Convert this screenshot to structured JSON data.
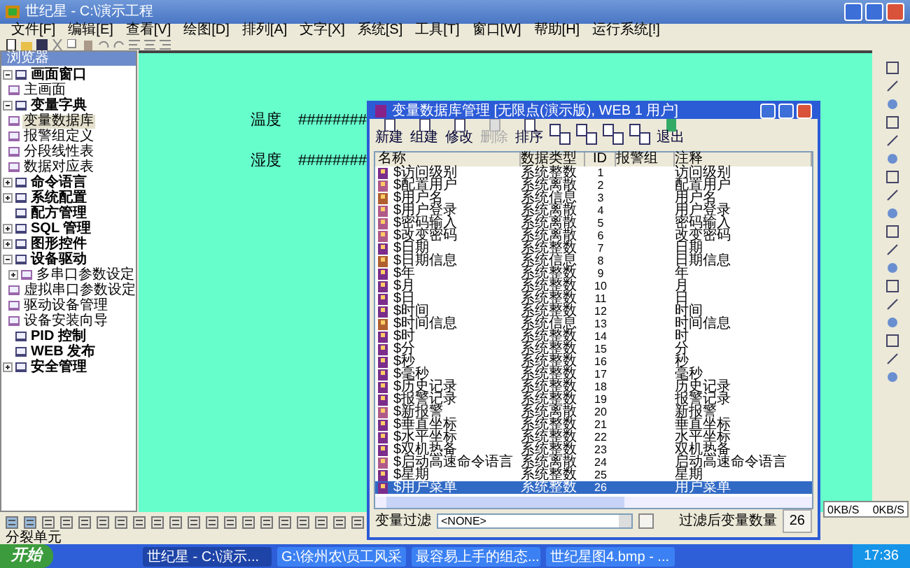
{
  "window": {
    "title": "世纪星 - C:\\演示工程"
  },
  "menu": [
    "文件[F]",
    "编辑[E]",
    "查看[V]",
    "绘图[D]",
    "排列[A]",
    "文字[X]",
    "系统[S]",
    "工具[T]",
    "窗口[W]",
    "帮助[H]",
    "运行系统[!]"
  ],
  "browser": {
    "title": "浏览器",
    "tree": [
      {
        "label": "画面窗口",
        "expanded": true,
        "children": [
          {
            "label": "主画面",
            "selected": false
          }
        ]
      },
      {
        "label": "变量字典",
        "expanded": true,
        "children": [
          {
            "label": "变量数据库",
            "selected": true
          },
          {
            "label": "报警组定义",
            "selected": false
          },
          {
            "label": "分段线性表",
            "selected": false
          },
          {
            "label": "数据对应表",
            "selected": false
          }
        ]
      },
      {
        "label": "命令语言",
        "expanded": false
      },
      {
        "label": "系统配置",
        "expanded": false
      },
      {
        "label": "配方管理"
      },
      {
        "label": "SQL 管理",
        "expanded": false
      },
      {
        "label": "图形控件",
        "expanded": false
      },
      {
        "label": "设备驱动",
        "expanded": true,
        "children": [
          {
            "label": "多串口参数设定",
            "selected": false,
            "expanded": false
          },
          {
            "label": "虚拟串口参数设定",
            "selected": false
          },
          {
            "label": "驱动设备管理",
            "selected": false
          },
          {
            "label": "设备安装向导",
            "selected": false
          }
        ]
      },
      {
        "label": "PID 控制"
      },
      {
        "label": "WEB 发布"
      },
      {
        "label": "安全管理",
        "expanded": false
      }
    ]
  },
  "canvas": {
    "fields": [
      {
        "label": "温度",
        "value": "########"
      },
      {
        "label": "湿度",
        "value": "########"
      }
    ]
  },
  "dialog": {
    "title": "变量数据库管理 [无限点(演示版), WEB 1 用户]",
    "toolbar": [
      {
        "label": "新建",
        "disabled": false
      },
      {
        "label": "组建",
        "disabled": false
      },
      {
        "label": "修改",
        "disabled": false
      },
      {
        "label": "删除",
        "disabled": true
      },
      {
        "label": "排序",
        "disabled": false
      }
    ],
    "exit_button": "退出",
    "columns": [
      "名称",
      "数据类型",
      "ID",
      "报警组",
      "注释"
    ],
    "rows": [
      {
        "kind": "integer",
        "name": "$访问级别",
        "type": "系统整数",
        "id": "1",
        "note": "访问级别",
        "selected": false
      },
      {
        "kind": "discrete",
        "name": "$配置用户",
        "type": "系统离散",
        "id": "2",
        "note": "配置用户",
        "selected": false
      },
      {
        "kind": "info",
        "name": "$用户名",
        "type": "系统信息",
        "id": "3",
        "note": "用户名",
        "selected": false
      },
      {
        "kind": "discrete",
        "name": "$用户登录",
        "type": "系统离散",
        "id": "4",
        "note": "用户登录",
        "selected": false
      },
      {
        "kind": "discrete",
        "name": "$密码输入",
        "type": "系统离散",
        "id": "5",
        "note": "密码输入",
        "selected": false
      },
      {
        "kind": "discrete",
        "name": "$改变密码",
        "type": "系统离散",
        "id": "6",
        "note": "改变密码",
        "selected": false
      },
      {
        "kind": "integer",
        "name": "$日期",
        "type": "系统整数",
        "id": "7",
        "note": "日期",
        "selected": false
      },
      {
        "kind": "info",
        "name": "$日期信息",
        "type": "系统信息",
        "id": "8",
        "note": "日期信息",
        "selected": false
      },
      {
        "kind": "integer",
        "name": "$年",
        "type": "系统整数",
        "id": "9",
        "note": "年",
        "selected": false
      },
      {
        "kind": "integer",
        "name": "$月",
        "type": "系统整数",
        "id": "10",
        "note": "月",
        "selected": false
      },
      {
        "kind": "integer",
        "name": "$日",
        "type": "系统整数",
        "id": "11",
        "note": "日",
        "selected": false
      },
      {
        "kind": "integer",
        "name": "$时间",
        "type": "系统整数",
        "id": "12",
        "note": "时间",
        "selected": false
      },
      {
        "kind": "info",
        "name": "$时间信息",
        "type": "系统信息",
        "id": "13",
        "note": "时间信息",
        "selected": false
      },
      {
        "kind": "integer",
        "name": "$时",
        "type": "系统整数",
        "id": "14",
        "note": "时",
        "selected": false
      },
      {
        "kind": "integer",
        "name": "$分",
        "type": "系统整数",
        "id": "15",
        "note": "分",
        "selected": false
      },
      {
        "kind": "integer",
        "name": "$秒",
        "type": "系统整数",
        "id": "16",
        "note": "秒",
        "selected": false
      },
      {
        "kind": "integer",
        "name": "$毫秒",
        "type": "系统整数",
        "id": "17",
        "note": "毫秒",
        "selected": false
      },
      {
        "kind": "integer",
        "name": "$历史记录",
        "type": "系统整数",
        "id": "18",
        "note": "历史记录",
        "selected": false
      },
      {
        "kind": "integer",
        "name": "$报警记录",
        "type": "系统整数",
        "id": "19",
        "note": "报警记录",
        "selected": false
      },
      {
        "kind": "discrete",
        "name": "$新报警",
        "type": "系统离散",
        "id": "20",
        "note": "新报警",
        "selected": false
      },
      {
        "kind": "integer",
        "name": "$垂直坐标",
        "type": "系统整数",
        "id": "21",
        "note": "垂直坐标",
        "selected": false
      },
      {
        "kind": "integer",
        "name": "$水平坐标",
        "type": "系统整数",
        "id": "22",
        "note": "水平坐标",
        "selected": false
      },
      {
        "kind": "integer",
        "name": "$双机热备",
        "type": "系统整数",
        "id": "23",
        "note": "双机热备",
        "selected": false
      },
      {
        "kind": "discrete",
        "name": "$启动高速命令语言",
        "type": "系统离散",
        "id": "24",
        "note": "启动高速命令语言",
        "selected": false
      },
      {
        "kind": "integer",
        "name": "$星期",
        "type": "系统整数",
        "id": "25",
        "note": "星期",
        "selected": false
      },
      {
        "kind": "integer",
        "name": "$用户菜单",
        "type": "系统整数",
        "id": "26",
        "note": "用户菜单",
        "selected": true
      }
    ],
    "filter": {
      "label": "变量过滤",
      "value": "<NONE>"
    },
    "count": {
      "label": "过滤后变量数量",
      "value": "26"
    }
  },
  "status_bar": "分裂单元",
  "net_speed": [
    "0KB/S",
    "0KB/S"
  ],
  "taskbar": {
    "start": "开始",
    "tasks": [
      {
        "label": "世纪星 - C:\\演示...",
        "selected": true
      },
      {
        "label": "G:\\徐州农\\员工风采",
        "selected": false
      },
      {
        "label": "最容易上手的组态...",
        "selected": false
      },
      {
        "label": "世纪星图4.bmp - ...",
        "selected": false
      }
    ],
    "clock": "17:36"
  }
}
